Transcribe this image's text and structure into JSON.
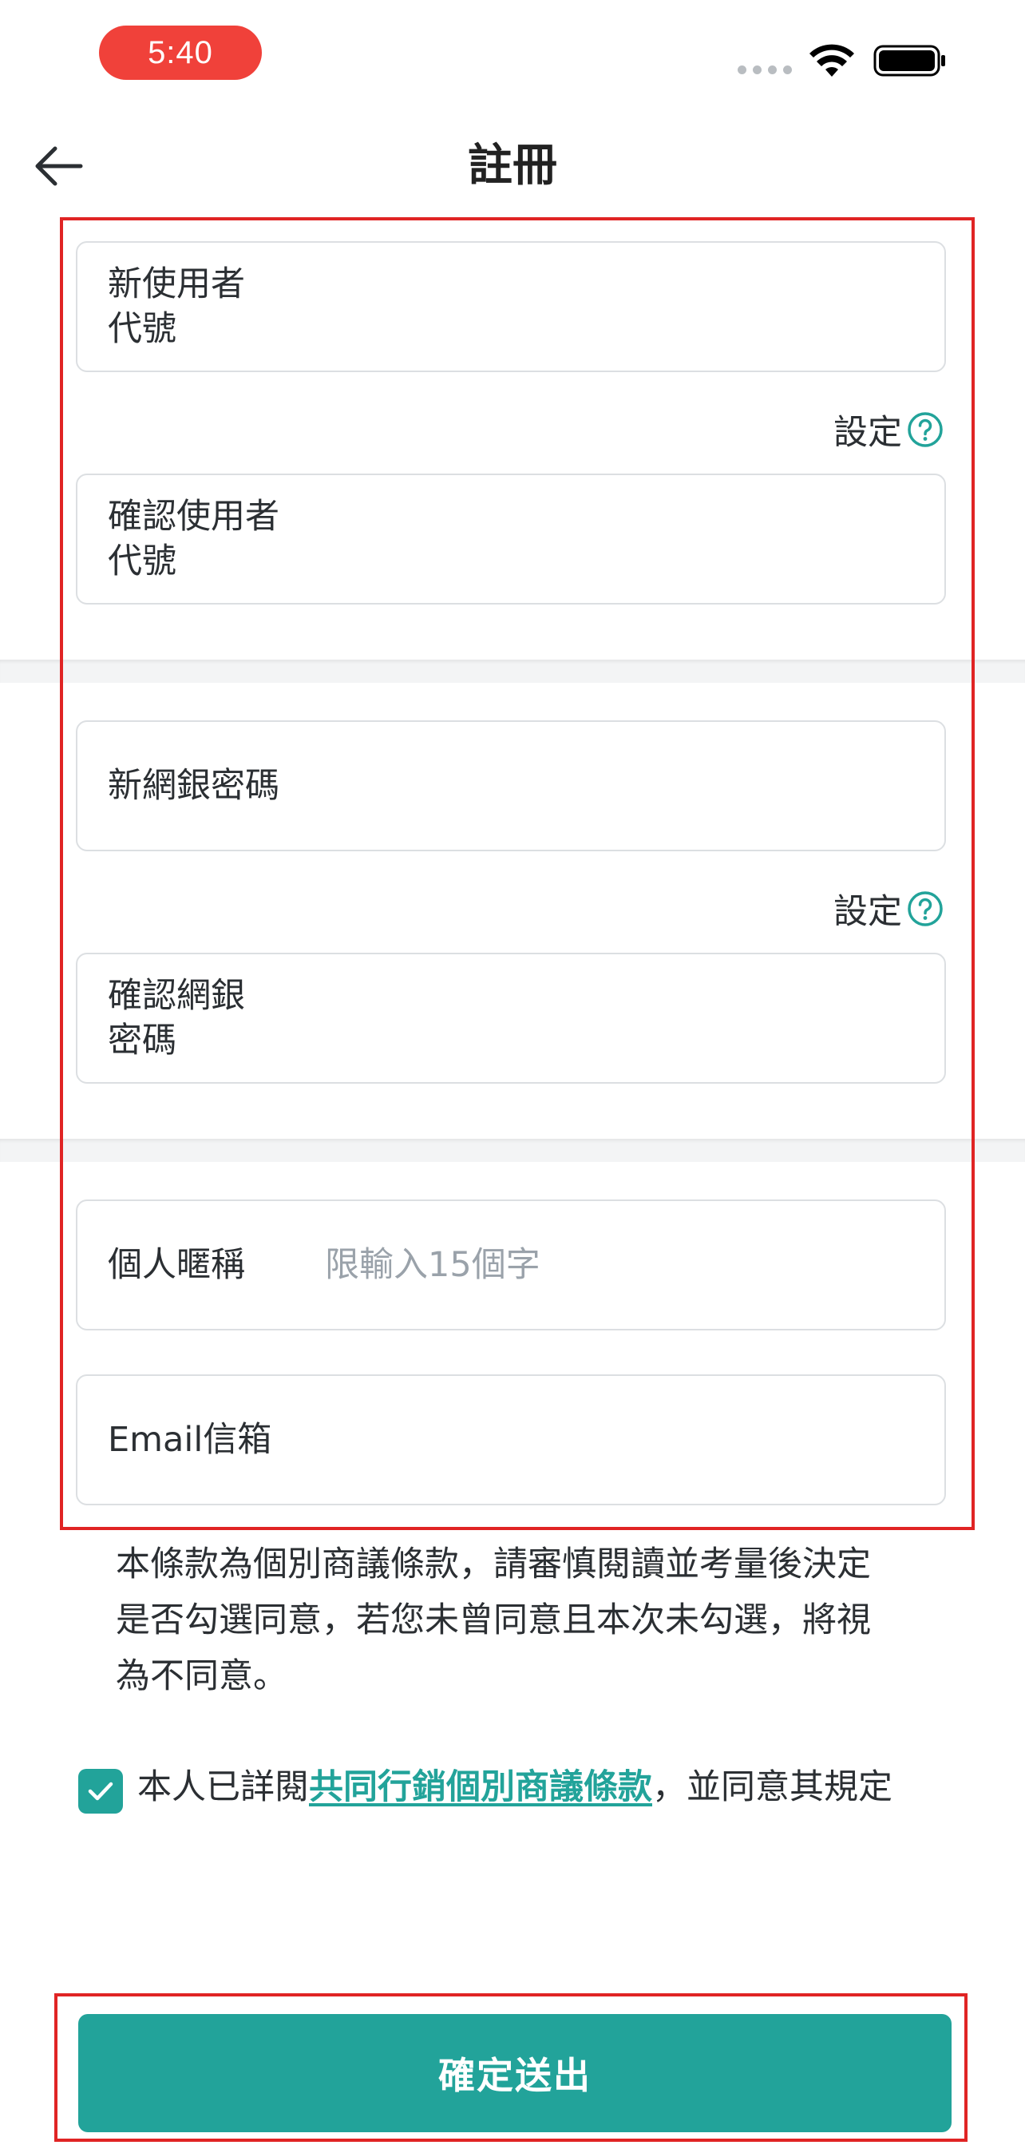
{
  "status_bar": {
    "time": "5:40"
  },
  "header": {
    "title": "註冊"
  },
  "section_user_id": {
    "new_label": "新使用者\n代號",
    "setting_label": "設定",
    "confirm_label": "確認使用者\n代號"
  },
  "section_password": {
    "new_label": "新網銀密碼",
    "setting_label": "設定",
    "confirm_label": "確認網銀\n密碼"
  },
  "section_profile": {
    "nickname_label": "個人暱稱",
    "nickname_placeholder": "限輸入15個字",
    "email_label": "Email信箱"
  },
  "terms": {
    "notice": "本條款為個別商議條款，請審慎閱讀並考量後決定是否勾選同意，若您未曾同意且本次未勾選，將視為不同意。",
    "agree_prefix": "本人已詳閱",
    "agree_link": "共同行銷個別商議條款",
    "agree_suffix": "，並同意其規定",
    "checked": true
  },
  "submit": {
    "label": "確定送出"
  },
  "colors": {
    "accent": "#22a39a",
    "annotation": "#e02424",
    "time_pill": "#f0413a"
  }
}
